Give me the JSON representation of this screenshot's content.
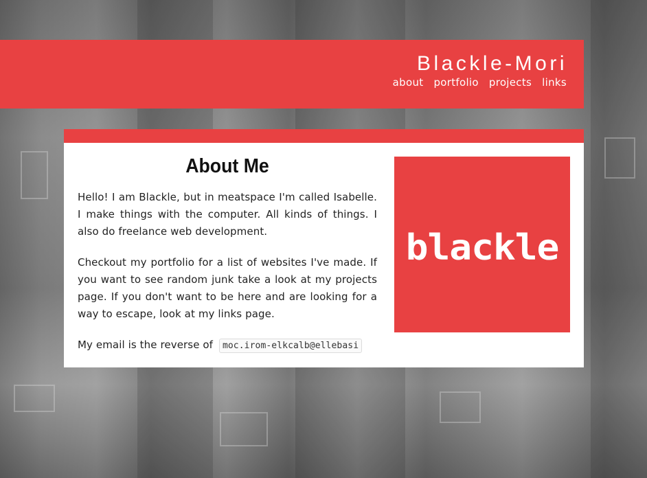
{
  "header": {
    "site_title": "Blackle-Mori",
    "nav": [
      "about",
      "portfolio",
      "projects",
      "links"
    ]
  },
  "about": {
    "title": "About Me",
    "paragraph1": "Hello! I am Blackle, but in meatspace I'm called Isabelle. I make things with the computer. All kinds of things. I also do freelance web development.",
    "paragraph2": "Checkout my portfolio for a list of websites I've made. If you want to see random junk take a look at my projects page. If you don't want to be here and are looking for a way to escape, look at my links page.",
    "email_prefix": "My email is the reverse of",
    "email_reversed": "moc.irom-elkcalb@ellebasi",
    "logo_text": "blackle"
  },
  "colors": {
    "accent": "#e84142",
    "card_bg": "#ffffff"
  }
}
